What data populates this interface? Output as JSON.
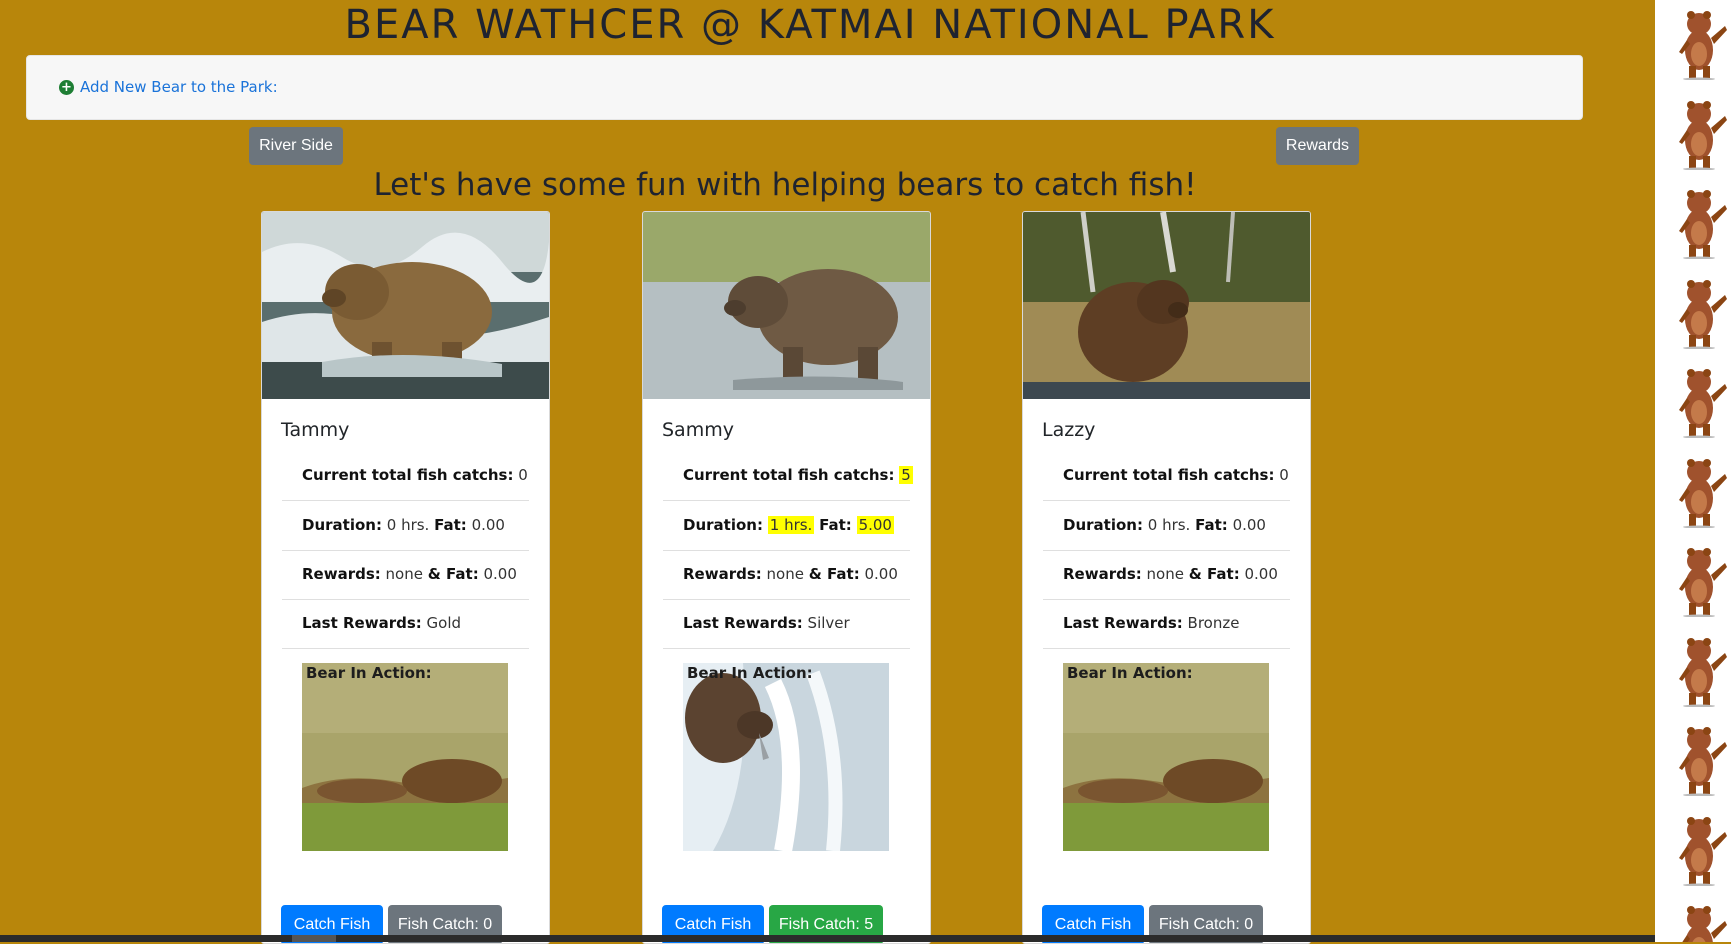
{
  "header": {
    "title": "BEAR WATHCER @ KATMAI NATIONAL PARK",
    "add_bear_label": "Add New Bear to the Park:"
  },
  "nav": {
    "river_side": "River Side",
    "rewards": "Rewards"
  },
  "subtitle": "Let's have some fun with helping bears to catch fish!",
  "labels": {
    "total_catch": "Current total fish catchs:",
    "duration": "Duration:",
    "hrs": "hrs.",
    "fat": "Fat:",
    "rewards": "Rewards:",
    "and_fat": "& Fat:",
    "last_rewards": "Last Rewards:",
    "bear_in_action": "Bear In Action:",
    "catch_fish": "Catch Fish"
  },
  "bears": [
    {
      "name": "Tammy",
      "total_catch": "0",
      "duration": "0",
      "fat": "0.00",
      "rewards": "none",
      "rewards_fat": "0.00",
      "last_rewards": "Gold",
      "fish_catch_label": "Fish Catch: 0",
      "highlight": false
    },
    {
      "name": "Sammy",
      "total_catch": "5",
      "duration": "1",
      "fat": "5.00",
      "rewards": "none",
      "rewards_fat": "0.00",
      "last_rewards": "Silver",
      "fish_catch_label": "Fish Catch: 5",
      "highlight": true
    },
    {
      "name": "Lazzy",
      "total_catch": "0",
      "duration": "0",
      "fat": "0.00",
      "rewards": "none",
      "rewards_fat": "0.00",
      "last_rewards": "Bronze",
      "fish_catch_label": "Fish Catch: 0",
      "highlight": false
    }
  ],
  "colors": {
    "page_background": "#b8860b",
    "highlight": "#ffff00",
    "primary_button": "#007bff",
    "secondary_button": "#6c757d",
    "success_button": "#28a745"
  }
}
